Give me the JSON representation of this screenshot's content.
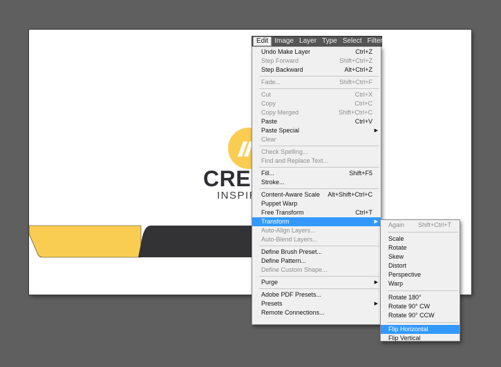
{
  "menubar": {
    "items": [
      {
        "label": "Edit",
        "active": true
      },
      {
        "label": "Image"
      },
      {
        "label": "Layer"
      },
      {
        "label": "Type"
      },
      {
        "label": "Select"
      },
      {
        "label": "Filter"
      }
    ]
  },
  "canvas": {
    "brand_name": "CREA",
    "brand_tagline": "INSPIRA",
    "colors": {
      "accent": "#f9cd51",
      "dark": "#333336",
      "background": "#ffffff"
    }
  },
  "edit_menu": {
    "groups": [
      [
        {
          "label": "Undo Make Layer",
          "shortcut": "Ctrl+Z",
          "enabled": true
        },
        {
          "label": "Step Forward",
          "shortcut": "Shift+Ctrl+Z",
          "enabled": false
        },
        {
          "label": "Step Backward",
          "shortcut": "Alt+Ctrl+Z",
          "enabled": true
        }
      ],
      [
        {
          "label": "Fade...",
          "shortcut": "Shift+Ctrl+F",
          "enabled": false
        }
      ],
      [
        {
          "label": "Cut",
          "shortcut": "Ctrl+X",
          "enabled": false
        },
        {
          "label": "Copy",
          "shortcut": "Ctrl+C",
          "enabled": false
        },
        {
          "label": "Copy Merged",
          "shortcut": "Shift+Ctrl+C",
          "enabled": false
        },
        {
          "label": "Paste",
          "shortcut": "Ctrl+V",
          "enabled": true
        },
        {
          "label": "Paste Special",
          "shortcut": "",
          "enabled": true,
          "submenu": true
        },
        {
          "label": "Clear",
          "shortcut": "",
          "enabled": false
        }
      ],
      [
        {
          "label": "Check Spelling...",
          "shortcut": "",
          "enabled": false
        },
        {
          "label": "Find and Replace Text...",
          "shortcut": "",
          "enabled": false
        }
      ],
      [
        {
          "label": "Fill...",
          "shortcut": "Shift+F5",
          "enabled": true
        },
        {
          "label": "Stroke...",
          "shortcut": "",
          "enabled": true
        }
      ],
      [
        {
          "label": "Content-Aware Scale",
          "shortcut": "Alt+Shift+Ctrl+C",
          "enabled": true
        },
        {
          "label": "Puppet Warp",
          "shortcut": "",
          "enabled": true
        },
        {
          "label": "Free Transform",
          "shortcut": "Ctrl+T",
          "enabled": true
        },
        {
          "label": "Transform",
          "shortcut": "",
          "enabled": true,
          "submenu": true,
          "highlight": true
        },
        {
          "label": "Auto-Align Layers...",
          "shortcut": "",
          "enabled": false
        },
        {
          "label": "Auto-Blend Layers...",
          "shortcut": "",
          "enabled": false
        }
      ],
      [
        {
          "label": "Define Brush Preset...",
          "shortcut": "",
          "enabled": true
        },
        {
          "label": "Define Pattern...",
          "shortcut": "",
          "enabled": true
        },
        {
          "label": "Define Custom Shape...",
          "shortcut": "",
          "enabled": false
        }
      ],
      [
        {
          "label": "Purge",
          "shortcut": "",
          "enabled": true,
          "submenu": true
        }
      ],
      [
        {
          "label": "Adobe PDF Presets...",
          "shortcut": "",
          "enabled": true
        },
        {
          "label": "Presets",
          "shortcut": "",
          "enabled": true,
          "submenu": true
        },
        {
          "label": "Remote Connections...",
          "shortcut": "",
          "enabled": true
        }
      ]
    ]
  },
  "transform_menu": {
    "groups": [
      [
        {
          "label": "Again",
          "shortcut": "Shift+Ctrl+T",
          "enabled": false
        }
      ],
      [
        {
          "label": "Scale",
          "enabled": true
        },
        {
          "label": "Rotate",
          "enabled": true
        },
        {
          "label": "Skew",
          "enabled": true
        },
        {
          "label": "Distort",
          "enabled": true
        },
        {
          "label": "Perspective",
          "enabled": true
        },
        {
          "label": "Warp",
          "enabled": true
        }
      ],
      [
        {
          "label": "Rotate 180°",
          "enabled": true
        },
        {
          "label": "Rotate 90° CW",
          "enabled": true
        },
        {
          "label": "Rotate 90° CCW",
          "enabled": true
        }
      ],
      [
        {
          "label": "Flip Horizontal",
          "enabled": true,
          "highlight": true
        },
        {
          "label": "Flip Vertical",
          "enabled": true
        }
      ]
    ]
  },
  "icons": {
    "submenu_arrow": "▶"
  }
}
